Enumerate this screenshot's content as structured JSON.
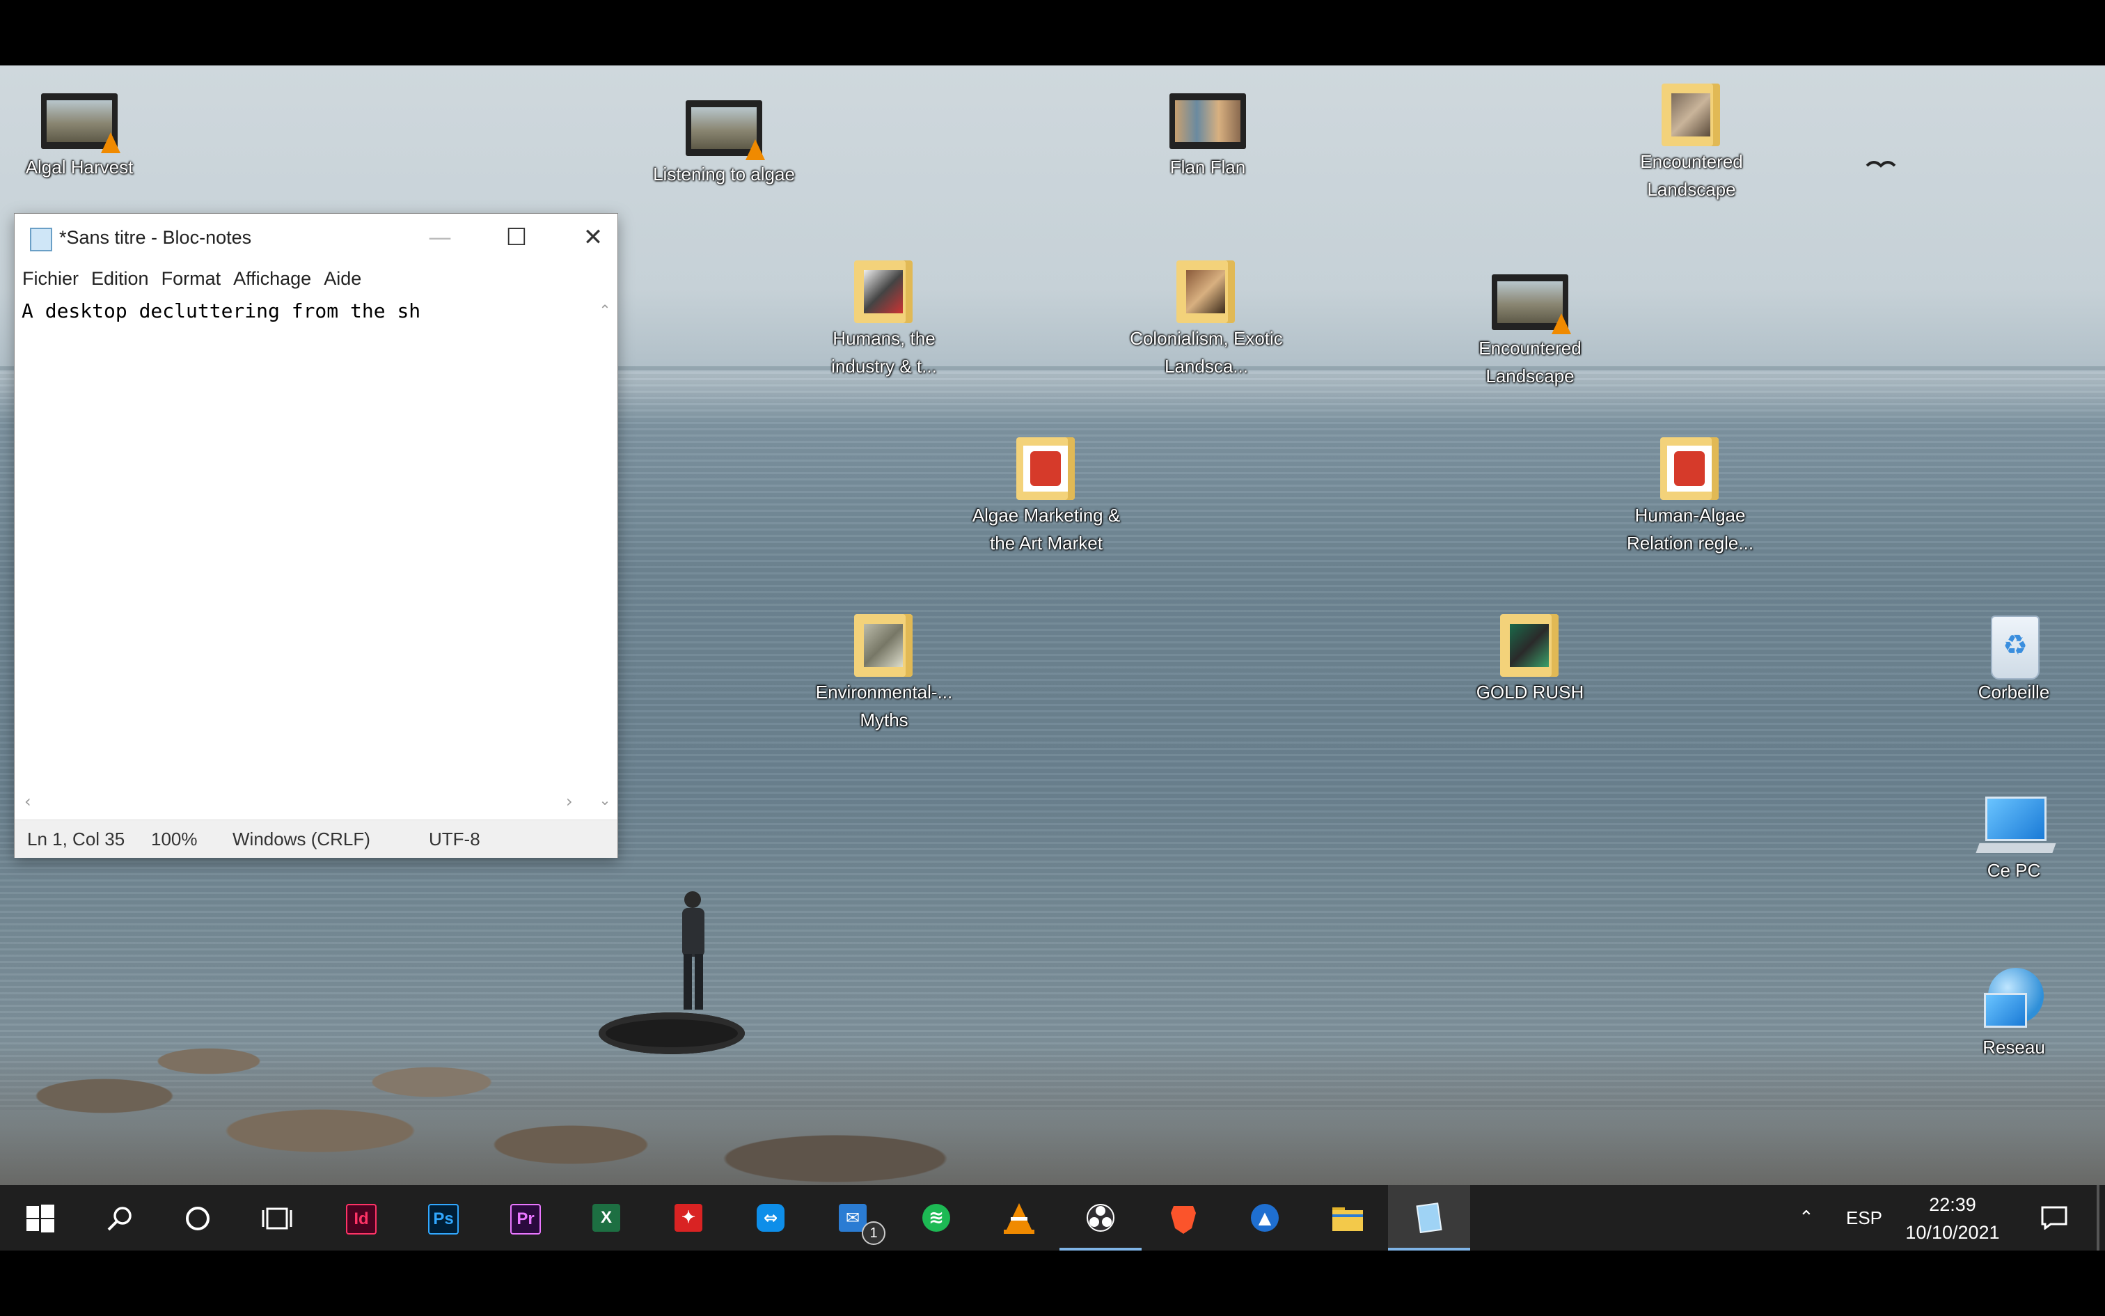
{
  "desktop_icons": [
    {
      "label": "Algal Harvest",
      "kind": "video"
    },
    {
      "label": "Listening to algae",
      "kind": "video"
    },
    {
      "label": "Flan Flan",
      "kind": "video"
    },
    {
      "label": "Encountered Landscape",
      "kind": "folder"
    },
    {
      "label": "Humans, the industry & t...",
      "kind": "folder"
    },
    {
      "label": "Colonialism, Exotic Landsca...",
      "kind": "folder"
    },
    {
      "label": "Encountered Landscape",
      "kind": "video"
    },
    {
      "label": "Algae Marketing & the Art Market",
      "kind": "folder-pdf"
    },
    {
      "label": "Human-Algae Relation regle...",
      "kind": "folder-pdf"
    },
    {
      "label": "Environmental-... Myths",
      "kind": "folder"
    },
    {
      "label": "GOLD RUSH",
      "kind": "folder"
    },
    {
      "label": "Corbeille",
      "kind": "recycle-bin"
    },
    {
      "label": "Ce PC",
      "kind": "computer"
    },
    {
      "label": "Reseau",
      "kind": "network"
    }
  ],
  "notepad": {
    "title": "*Sans titre - Bloc-notes",
    "menu": [
      "Fichier",
      "Edition",
      "Format",
      "Affichage",
      "Aide"
    ],
    "content": "A desktop decluttering from the sh",
    "status": {
      "position": "Ln 1, Col 35",
      "zoom": "100%",
      "line_ending": "Windows (CRLF)",
      "encoding": "UTF-8"
    }
  },
  "taskbar": {
    "apps": [
      {
        "name": "start",
        "icon": "windows-logo-icon"
      },
      {
        "name": "search",
        "icon": "search-icon"
      },
      {
        "name": "cortana",
        "icon": "circle-icon"
      },
      {
        "name": "task-view",
        "icon": "task-view-icon"
      },
      {
        "name": "indesign",
        "icon": "indesign-icon",
        "glyph": "Id",
        "color": "#49021f"
      },
      {
        "name": "photoshop",
        "icon": "photoshop-icon",
        "glyph": "Ps",
        "color": "#001e36"
      },
      {
        "name": "premiere",
        "icon": "premiere-icon",
        "glyph": "Pr",
        "color": "#2a0a3d"
      },
      {
        "name": "excel",
        "icon": "excel-icon",
        "glyph": "X",
        "color": "#1d6f42"
      },
      {
        "name": "acrobat",
        "icon": "acrobat-icon",
        "color": "#d92323"
      },
      {
        "name": "teamviewer",
        "icon": "teamviewer-icon",
        "color": "#0e8ee9"
      },
      {
        "name": "mail",
        "icon": "mail-icon",
        "badge": "1",
        "color": "#2b7cd3"
      },
      {
        "name": "spotify",
        "icon": "spotify-icon",
        "color": "#1db954"
      },
      {
        "name": "vlc",
        "icon": "vlc-icon",
        "color": "#f08a00"
      },
      {
        "name": "obs",
        "icon": "obs-icon",
        "color": "#302e31"
      },
      {
        "name": "brave",
        "icon": "brave-icon",
        "color": "#fb542b"
      },
      {
        "name": "app-blue",
        "icon": "blue-circle-app-icon",
        "color": "#1f6fd0"
      },
      {
        "name": "explorer",
        "icon": "folder-icon",
        "color": "#f3c94a"
      },
      {
        "name": "notepad",
        "icon": "notepad-icon",
        "color": "#9fd3f5"
      }
    ],
    "tray": {
      "language": "ESP",
      "time": "22:39",
      "date": "10/10/2021"
    }
  },
  "colors": {
    "taskbar_bg": "#1f1f1f",
    "active_underline": "#7fb4e6"
  }
}
